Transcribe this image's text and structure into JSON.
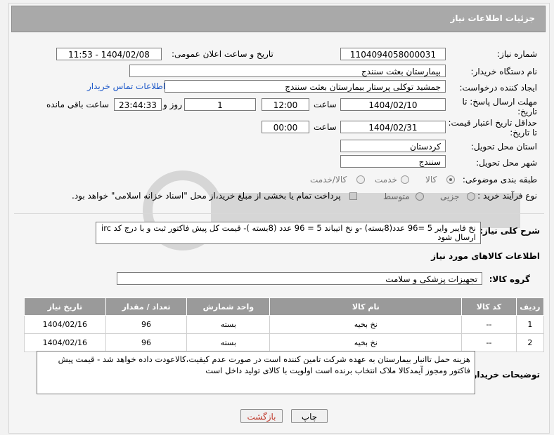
{
  "header": {
    "title": "جزئیات اطلاعات نیاز"
  },
  "fields": {
    "need_number_label": "شماره نیاز:",
    "need_number": "1104094058000031",
    "announce_label": "تاریخ و ساعت اعلان عمومی:",
    "announce_value": "1404/02/08 - 11:53",
    "buyer_org_label": "نام دستگاه خریدار:",
    "buyer_org": "بیمارستان بعثت سنندج",
    "creator_label": "ایجاد کننده درخواست:",
    "creator": "جمشید  توکلی پرستار بیمارستان بعثت سنندج",
    "contact_link": "اطلاعات تماس خریدار",
    "deadline_label_1": "مهلت ارسال پاسخ: تا",
    "deadline_label_2": "تاریخ:",
    "deadline_date": "1404/02/10",
    "time_label": "ساعت",
    "deadline_time": "12:00",
    "days_value": "1",
    "days_label": "روز و",
    "remaining_time": "23:44:33",
    "remaining_label": "ساعت باقی مانده",
    "validity_label_1": "حداقل تاریخ اعتبار قیمت:",
    "validity_label_2": "تا تاریخ:",
    "validity_date": "1404/02/31",
    "validity_time": "00:00",
    "province_label": "استان محل تحویل:",
    "province": "کردستان",
    "city_label": "شهر محل تحویل:",
    "city": "سنندج",
    "category_label": "طبقه بندی موضوعی:",
    "category_options": [
      "کالا",
      "خدمت",
      "کالا/خدمت"
    ],
    "process_label": "نوع فرآیند خرید :",
    "process_options": [
      "جزیی",
      "متوسط"
    ],
    "payment_note": "پرداخت تمام یا بخشی از مبلغ خرید،از محل \"اسناد خزانه اسلامی\" خواهد بود.",
    "desc_label": "شرح کلی نیاز:",
    "desc_text": "نخ فایبر وایر 5 =96 عدد(8بسته) -و نخ اتیباند 5 = 96 عدد (8بسته )- قیمت کل پیش فاکتور ثبت و با درج کد irc ارسال شود"
  },
  "goods": {
    "section_title": "اطلاعات کالاهای مورد نیاز",
    "group_label": "گروه کالا:",
    "group_value": "تجهیزات پزشکی و سلامت",
    "columns": [
      "ردیف",
      "کد کالا",
      "نام کالا",
      "واحد شمارش",
      "تعداد / مقدار",
      "تاریخ نیاز"
    ],
    "rows": [
      [
        "1",
        "--",
        "نخ بخیه",
        "بسته",
        "96",
        "1404/02/16"
      ],
      [
        "2",
        "--",
        "نخ بخیه",
        "بسته",
        "96",
        "1404/02/16"
      ]
    ]
  },
  "buyer_notes": {
    "label": "توضیحات خریدار:",
    "text": "هزینه حمل تاانبار بیمارستان به عهده شرکت تامین کننده است در صورت عدم کیفیت،کالاعودت داده خواهد شد - قیمت پیش فاکتور ومجوز آیمدکالا ملاک انتخاب برنده است اولویت با کالای تولید داخل است"
  },
  "buttons": {
    "print": "چاپ",
    "back": "بازگشت"
  },
  "colors": {
    "header_bg": "#a9a9a9",
    "link": "#1a56c8",
    "table_header": "#9a9a9a",
    "back_text": "#c0392b"
  }
}
